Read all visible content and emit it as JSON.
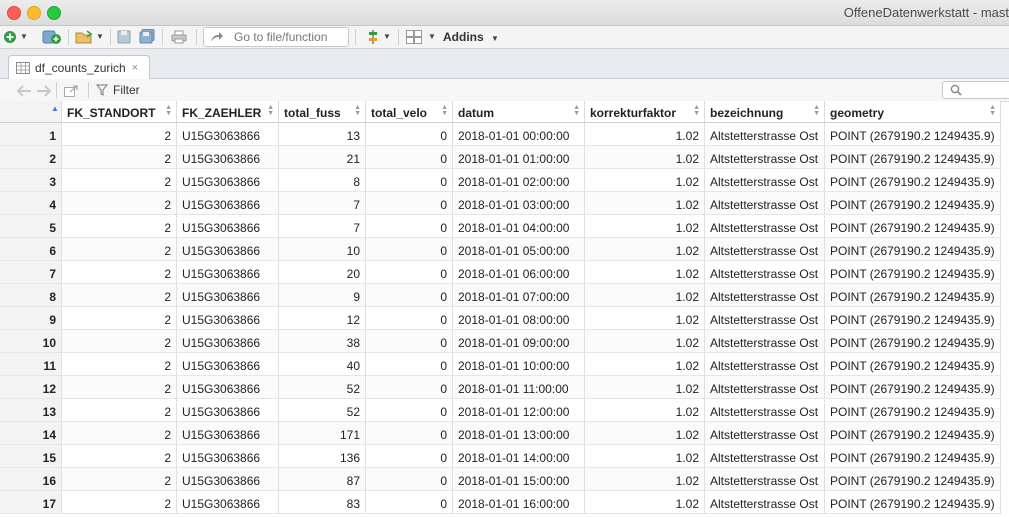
{
  "window": {
    "title": "OffeneDatenwerkstatt - mast"
  },
  "toolbar": {
    "goto_placeholder": "Go to file/function",
    "addins_label": "Addins"
  },
  "tab": {
    "label": "df_counts_zurich",
    "close": "×"
  },
  "filter": {
    "label": "Filter"
  },
  "table": {
    "columns": [
      "FK_STANDORT",
      "FK_ZAEHLER",
      "total_fuss",
      "total_velo",
      "datum",
      "korrekturfaktor",
      "bezeichnung",
      "geometry"
    ],
    "rows": [
      [
        "1",
        "2",
        "U15G3063866",
        "13",
        "0",
        "2018-01-01 00:00:00",
        "1.02",
        "Altstetterstrasse Ost",
        "POINT (2679190.2 1249435.9)"
      ],
      [
        "2",
        "2",
        "U15G3063866",
        "21",
        "0",
        "2018-01-01 01:00:00",
        "1.02",
        "Altstetterstrasse Ost",
        "POINT (2679190.2 1249435.9)"
      ],
      [
        "3",
        "2",
        "U15G3063866",
        "8",
        "0",
        "2018-01-01 02:00:00",
        "1.02",
        "Altstetterstrasse Ost",
        "POINT (2679190.2 1249435.9)"
      ],
      [
        "4",
        "2",
        "U15G3063866",
        "7",
        "0",
        "2018-01-01 03:00:00",
        "1.02",
        "Altstetterstrasse Ost",
        "POINT (2679190.2 1249435.9)"
      ],
      [
        "5",
        "2",
        "U15G3063866",
        "7",
        "0",
        "2018-01-01 04:00:00",
        "1.02",
        "Altstetterstrasse Ost",
        "POINT (2679190.2 1249435.9)"
      ],
      [
        "6",
        "2",
        "U15G3063866",
        "10",
        "0",
        "2018-01-01 05:00:00",
        "1.02",
        "Altstetterstrasse Ost",
        "POINT (2679190.2 1249435.9)"
      ],
      [
        "7",
        "2",
        "U15G3063866",
        "20",
        "0",
        "2018-01-01 06:00:00",
        "1.02",
        "Altstetterstrasse Ost",
        "POINT (2679190.2 1249435.9)"
      ],
      [
        "8",
        "2",
        "U15G3063866",
        "9",
        "0",
        "2018-01-01 07:00:00",
        "1.02",
        "Altstetterstrasse Ost",
        "POINT (2679190.2 1249435.9)"
      ],
      [
        "9",
        "2",
        "U15G3063866",
        "12",
        "0",
        "2018-01-01 08:00:00",
        "1.02",
        "Altstetterstrasse Ost",
        "POINT (2679190.2 1249435.9)"
      ],
      [
        "10",
        "2",
        "U15G3063866",
        "38",
        "0",
        "2018-01-01 09:00:00",
        "1.02",
        "Altstetterstrasse Ost",
        "POINT (2679190.2 1249435.9)"
      ],
      [
        "11",
        "2",
        "U15G3063866",
        "40",
        "0",
        "2018-01-01 10:00:00",
        "1.02",
        "Altstetterstrasse Ost",
        "POINT (2679190.2 1249435.9)"
      ],
      [
        "12",
        "2",
        "U15G3063866",
        "52",
        "0",
        "2018-01-01 11:00:00",
        "1.02",
        "Altstetterstrasse Ost",
        "POINT (2679190.2 1249435.9)"
      ],
      [
        "13",
        "2",
        "U15G3063866",
        "52",
        "0",
        "2018-01-01 12:00:00",
        "1.02",
        "Altstetterstrasse Ost",
        "POINT (2679190.2 1249435.9)"
      ],
      [
        "14",
        "2",
        "U15G3063866",
        "171",
        "0",
        "2018-01-01 13:00:00",
        "1.02",
        "Altstetterstrasse Ost",
        "POINT (2679190.2 1249435.9)"
      ],
      [
        "15",
        "2",
        "U15G3063866",
        "136",
        "0",
        "2018-01-01 14:00:00",
        "1.02",
        "Altstetterstrasse Ost",
        "POINT (2679190.2 1249435.9)"
      ],
      [
        "16",
        "2",
        "U15G3063866",
        "87",
        "0",
        "2018-01-01 15:00:00",
        "1.02",
        "Altstetterstrasse Ost",
        "POINT (2679190.2 1249435.9)"
      ],
      [
        "17",
        "2",
        "U15G3063866",
        "83",
        "0",
        "2018-01-01 16:00:00",
        "1.02",
        "Altstetterstrasse Ost",
        "POINT (2679190.2 1249435.9)"
      ]
    ]
  }
}
